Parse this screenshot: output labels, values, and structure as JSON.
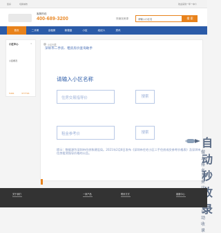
{
  "topbar": {
    "left_1": "您好",
    "left_2": "切换城市",
    "right": "欢迎来到一年一中介"
  },
  "header": {
    "hotline_label": "客服热线",
    "hotline": "400-689-3200",
    "search_label": "快速找房源",
    "search_placeholder": "请输入小区名",
    "search_button": "搜 索"
  },
  "nav": {
    "items": [
      "首页",
      "二手房",
      "出租房",
      "新楼盘",
      "小区",
      "经纪人",
      "资讯"
    ]
  },
  "sidebar": {
    "title": "小区中心",
    "close": "×",
    "subtitle": "小区概况",
    "stat1_label": "小区",
    "stat1_value": "5461",
    "stat2_label": "房产",
    "stat2_value": "377716"
  },
  "main": {
    "breadcrumb": "小区列表",
    "subtitle": "深圳市二手房、租房房价查询助手",
    "heading": "请输入小区名称",
    "field1_placeholder": "住房交易指导价",
    "button1": "搜索",
    "field2_placeholder": "租金参考价",
    "button2": "搜索",
    "tip": "提示：数据源为深圳市住房和建设局。2021年2月8日发布《深圳市住宅小区二手住房成交参考价格表》及深圳市住房租赁指导价格的公告。"
  },
  "watermark": {
    "title": "自动秒收录",
    "sub": "做上排名 → 来访一次 → 自动收录"
  },
  "footer": {
    "items": [
      "关于我们",
      "一家产品",
      "联系方式",
      "客服中心"
    ]
  },
  "colors": {
    "accent": "#e8821b",
    "nav_blue": "#2b5ba8"
  }
}
